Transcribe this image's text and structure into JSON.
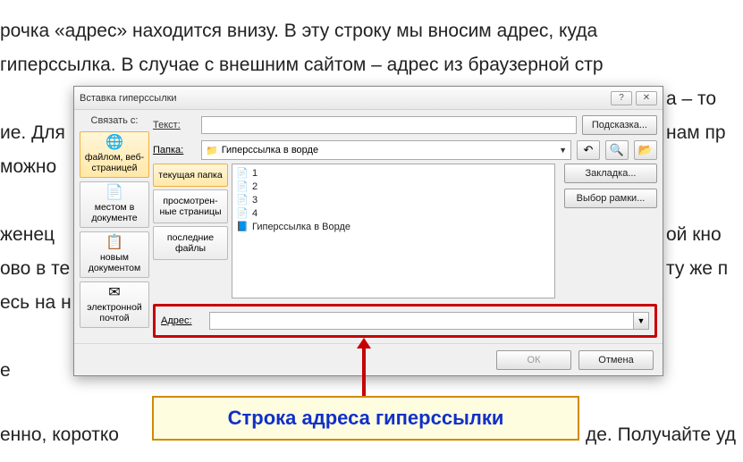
{
  "bg": {
    "l1": "рочка «адрес» находится внизу. В эту строку мы вносим адрес, куда",
    "l2": "гиперссылка. В случае с внешним сайтом – адрес из браузерной стр",
    "l3_right": "а – то",
    "l4_left": "ие. Для",
    "l4_right": "нам пр",
    "l5_left": "можно",
    "l6_left": "женец",
    "l6_right": "ой кно",
    "l7_left": "ово в те",
    "l7_right": "ту же п",
    "l8_left": "есь на н",
    "l9_left": "е",
    "l10": "енно, коротко",
    "l10_right": "де. Получайте уд"
  },
  "dialog": {
    "title": "Вставка гиперссылки",
    "link_with_label": "Связать с:",
    "text_label": "Текст:",
    "text_value": "",
    "hint_btn": "Подсказка...",
    "folder_label": "Папка:",
    "folder_value": "Гиперссылка в ворде",
    "bookmark_btn": "Закладка...",
    "frame_btn": "Выбор рамки...",
    "address_label": "Адрес:",
    "address_value": "",
    "ok": "ОК",
    "cancel": "Отмена",
    "link_types": [
      {
        "label": "файлом, веб-страницей",
        "icon": "🌐"
      },
      {
        "label": "местом в документе",
        "icon": "📄"
      },
      {
        "label": "новым документом",
        "icon": "📋"
      },
      {
        "label": "электронной почтой",
        "icon": "✉"
      }
    ],
    "subnav": [
      "текущая папка",
      "просмотрен-ные страницы",
      "последние файлы"
    ],
    "files": [
      {
        "icon": "📄",
        "name": "1"
      },
      {
        "icon": "📄",
        "name": "2"
      },
      {
        "icon": "📄",
        "name": "3"
      },
      {
        "icon": "📄",
        "name": "4"
      },
      {
        "icon": "📘",
        "name": "Гиперссылка в Ворде"
      }
    ]
  },
  "callout": "Строка адреса гиперссылки"
}
